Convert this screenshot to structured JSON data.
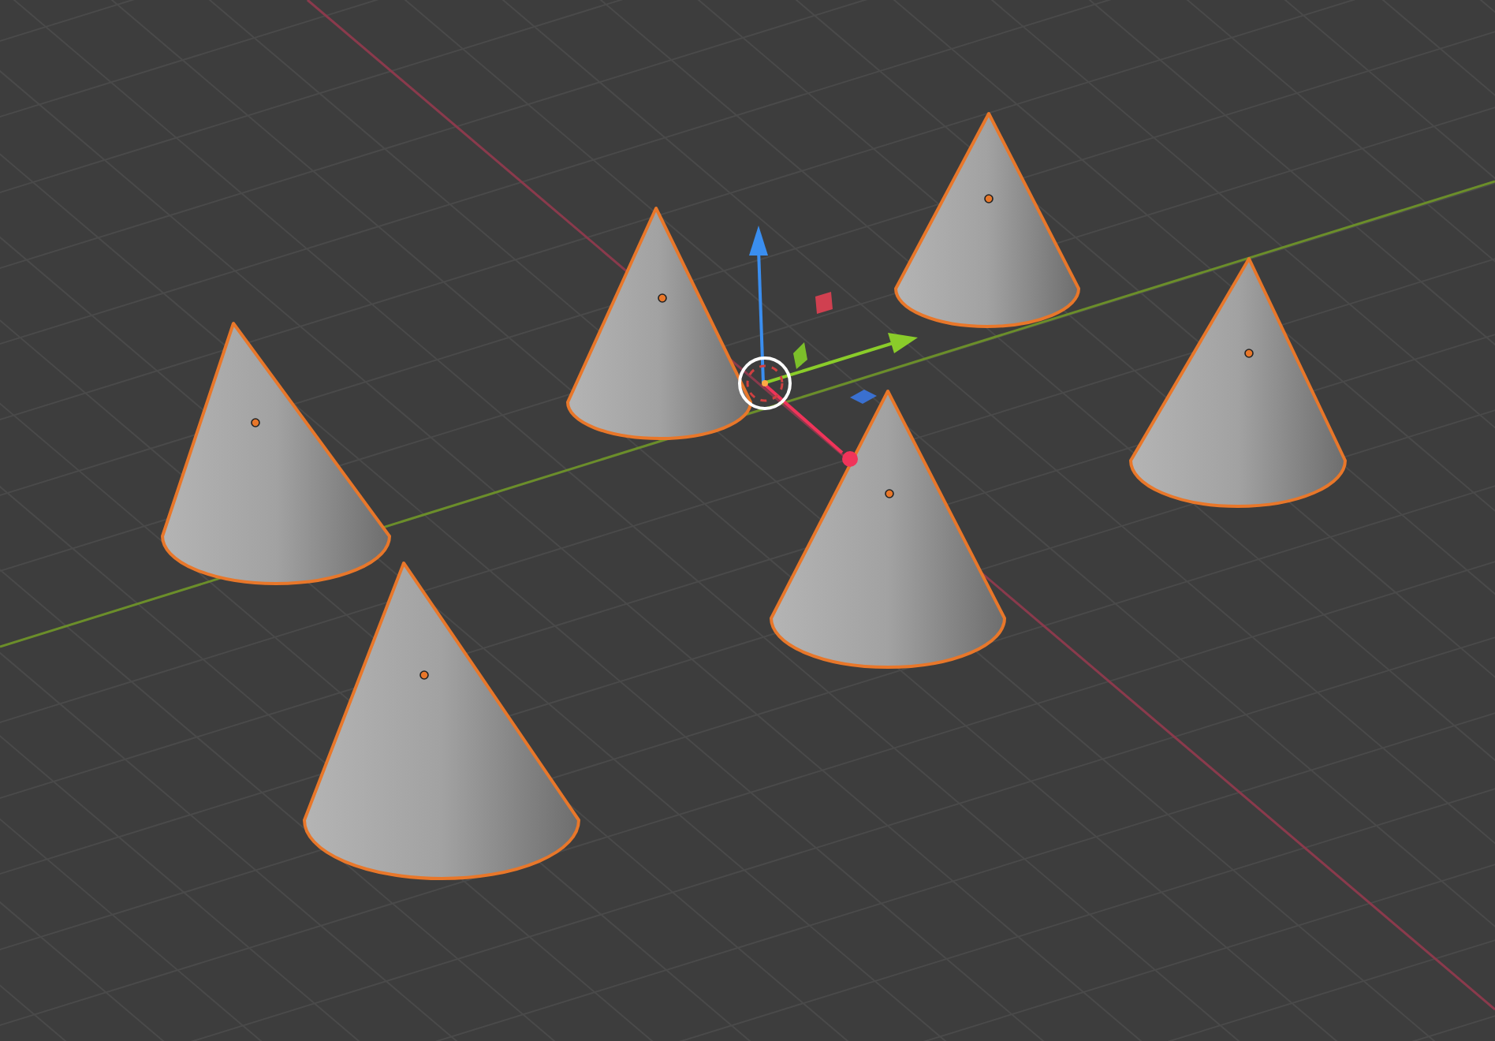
{
  "viewport": {
    "objects": [
      {
        "kind": "cone",
        "selected": true
      },
      {
        "kind": "cone",
        "selected": true
      },
      {
        "kind": "cone",
        "selected": true
      },
      {
        "kind": "cone",
        "selected": true
      },
      {
        "kind": "cone",
        "selected": true
      },
      {
        "kind": "cone",
        "selected": true
      }
    ]
  }
}
